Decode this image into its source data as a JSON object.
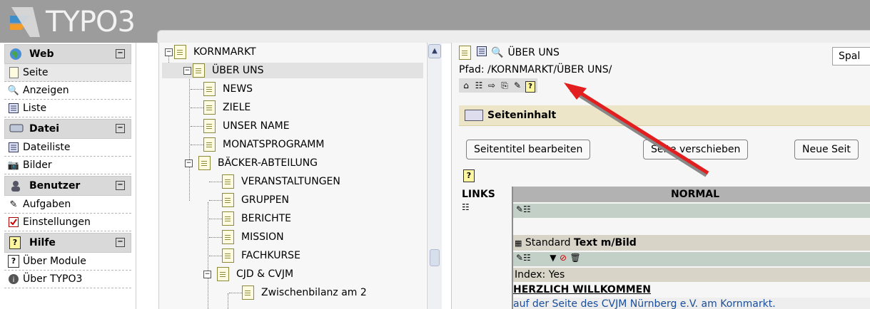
{
  "app": {
    "logo_text": "TYPO3"
  },
  "menu": {
    "groups": [
      {
        "label": "Web",
        "icon": "globe-icon",
        "items": [
          {
            "label": "Seite",
            "icon": "page-icon",
            "active": true
          },
          {
            "label": "Anzeigen",
            "icon": "magnifier-icon"
          },
          {
            "label": "Liste",
            "icon": "list-icon"
          }
        ]
      },
      {
        "label": "Datei",
        "icon": "drive-icon",
        "items": [
          {
            "label": "Dateiliste",
            "icon": "list-icon"
          },
          {
            "label": "Bilder",
            "icon": "camera-icon"
          }
        ]
      },
      {
        "label": "Benutzer",
        "icon": "user-icon",
        "items": [
          {
            "label": "Aufgaben",
            "icon": "tasks-icon"
          },
          {
            "label": "Einstellungen",
            "icon": "checkbox-icon"
          }
        ]
      },
      {
        "label": "Hilfe",
        "icon": "help-icon",
        "items": [
          {
            "label": "Über Module",
            "icon": "help-icon"
          },
          {
            "label": "Über TYPO3",
            "icon": "info-icon"
          }
        ]
      }
    ]
  },
  "tree": {
    "root": "KORNMARKT",
    "selected": "ÜBER UNS",
    "children": [
      "NEWS",
      "ZIELE",
      "UNSER NAME",
      "MONATSPROGRAMM",
      "BÄCKER-ABTEILUNG"
    ],
    "baecker_children": [
      "VERANSTALTUNGEN",
      "GRUPPEN",
      "BERICHTE",
      "MISSION",
      "FACHKURSE",
      "CJD & CVJM"
    ],
    "cjd_children": [
      "Zwischenbilanz am 2"
    ]
  },
  "content": {
    "page_title": "ÜBER UNS",
    "path": "Pfad: /KORNMARKT/ÜBER UNS/",
    "columns_select": "Spal",
    "section_title": "Seiteninhalt",
    "buttons": [
      "Seitentitel bearbeiten",
      "Seite verschieben",
      "Neue Seit"
    ],
    "col_left": "LINKS",
    "col_normal": "NORMAL",
    "ce_type": "Standard",
    "ce_title": "Text m/Bild",
    "index_text": "Index: Yes",
    "headline": "HERZLICH WILLKOMMEN",
    "bodytext": "auf der Seite des CVJM Nürnberg e.V. am Kornmarkt."
  },
  "colors": {
    "topbar": "#9c9c9c",
    "arrow": "#e31e1e",
    "section_bg": "#ece5c8",
    "row_green": "#c3d0c8"
  }
}
